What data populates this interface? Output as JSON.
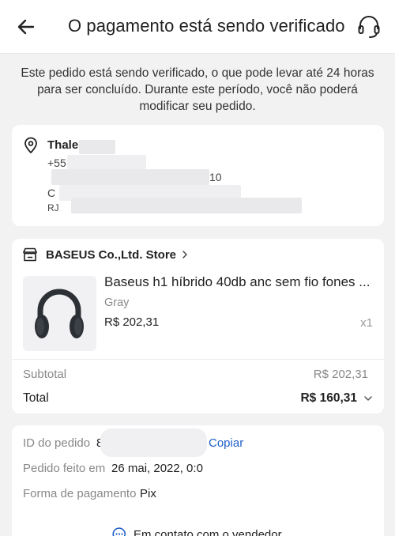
{
  "header": {
    "title": "O pagamento está sendo verificado",
    "back_icon": "arrow-left-icon",
    "support_icon": "headset-icon"
  },
  "notice": "Este pedido está sendo verificado, o que pode levar até 24 horas para ser concluído. Durante este período, você não poderá modificar seu pedido.",
  "address": {
    "name": "Thale",
    "line1": "+55",
    "line2": "10",
    "line3": "C",
    "line4": "RJ"
  },
  "order": {
    "store_name": "BASEUS Co.,Ltd. Store",
    "product_title": "Baseus h1 híbrido 40db anc sem fio fones ...",
    "variant": "Gray",
    "price": "R$ 202,31",
    "quantity": "x1",
    "subtotal_label": "Subtotal",
    "subtotal_value": "R$ 202,31",
    "total_label": "Total",
    "total_value": "R$ 160,31"
  },
  "info": {
    "order_id_label": "ID do pedido",
    "order_id_value": "8",
    "copy_label": "Copiar",
    "placed_label": "Pedido feito em",
    "placed_value": "26 mai, 2022, 0:0",
    "payment_label": "Forma de pagamento",
    "payment_value": "Pix",
    "contact_label": "Em contato com o vendedor"
  },
  "colors": {
    "link": "#1e5fc7",
    "background": "#f2f2f2"
  }
}
